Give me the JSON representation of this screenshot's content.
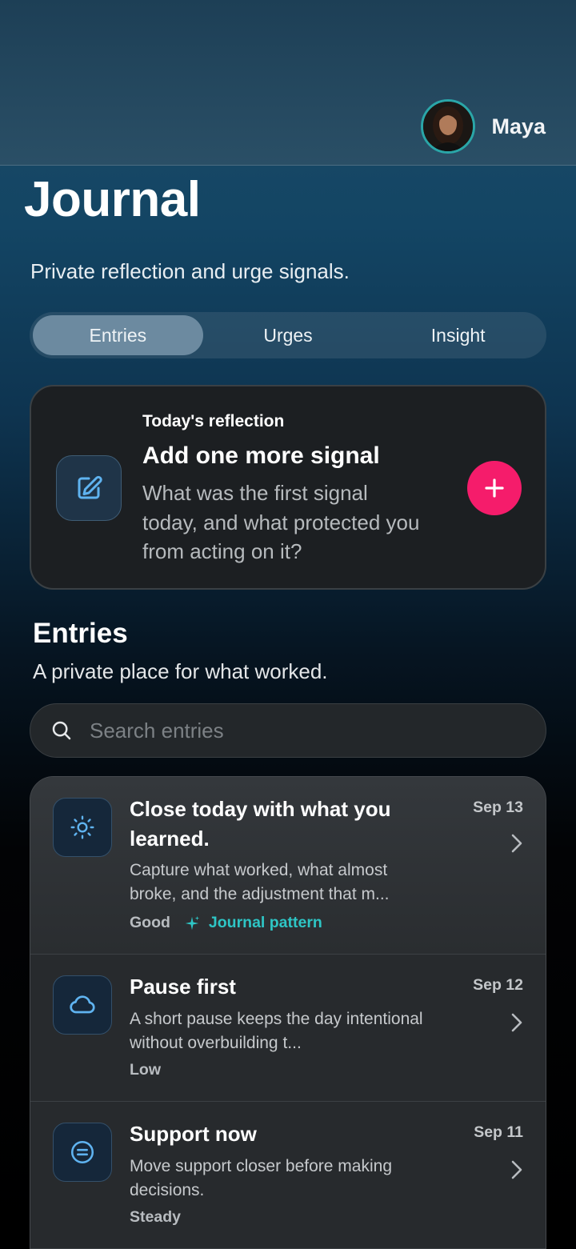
{
  "colors": {
    "accent": "#f51c6b",
    "teal": "#2ec5c5",
    "card": "#1c1f22"
  },
  "profile": {
    "name": "Maya"
  },
  "page": {
    "title": "Journal",
    "subtitle": "Private reflection and urge signals."
  },
  "tabs": [
    {
      "label": "Entries",
      "active": true
    },
    {
      "label": "Urges",
      "active": false
    },
    {
      "label": "Insight",
      "active": false
    }
  ],
  "reflection": {
    "kicker": "Today's reflection",
    "title": "Add one more signal",
    "body": "What was the first signal today, and what protected you from acting on it?",
    "icon": "edit-icon"
  },
  "entries_section": {
    "title": "Entries",
    "subtitle": "A private place for what worked.",
    "search_placeholder": "Search entries"
  },
  "entries": [
    {
      "title": "Close today with what you learned.",
      "description": "Capture what worked, what almost broke, and the adjustment that m...",
      "mood": "Good",
      "tag": "Journal pattern",
      "date": "Sep 13",
      "icon": "sun-icon"
    },
    {
      "title": "Pause first",
      "description": "A short pause keeps the day intentional without overbuilding t...",
      "mood": "Low",
      "date": "Sep 12",
      "icon": "cloud-icon"
    },
    {
      "title": "Support now",
      "description": "Move support closer before making decisions.",
      "mood": "Steady",
      "date": "Sep 11",
      "icon": "equal-circle-icon"
    }
  ]
}
